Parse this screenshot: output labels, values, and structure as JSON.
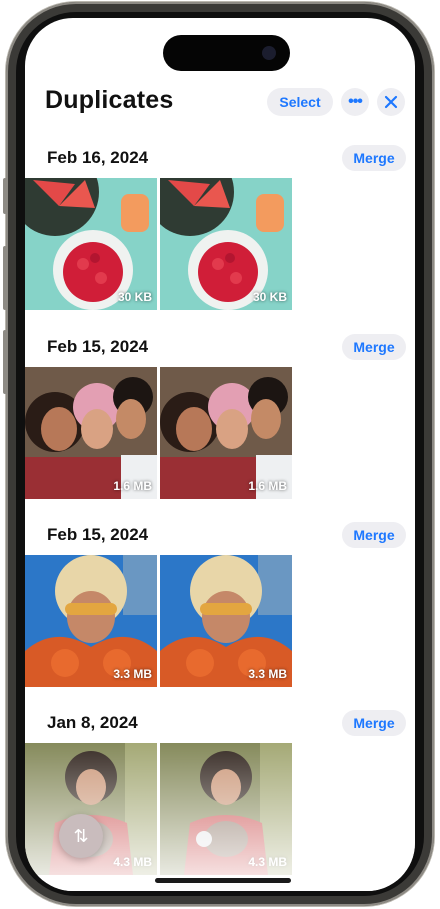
{
  "header": {
    "title": "Duplicates",
    "select_label": "Select",
    "more_label": "•••",
    "close_label": "✕"
  },
  "groups": [
    {
      "date": "Feb 16, 2024",
      "merge_label": "Merge",
      "items": [
        {
          "size": "30 KB"
        },
        {
          "size": "30 KB"
        }
      ]
    },
    {
      "date": "Feb 15, 2024",
      "merge_label": "Merge",
      "items": [
        {
          "size": "1.6 MB"
        },
        {
          "size": "1.6 MB"
        }
      ]
    },
    {
      "date": "Feb 15, 2024",
      "merge_label": "Merge",
      "items": [
        {
          "size": "3.3 MB"
        },
        {
          "size": "3.3 MB"
        }
      ]
    },
    {
      "date": "Jan 8, 2024",
      "merge_label": "Merge",
      "items": [
        {
          "size": "4.3 MB"
        },
        {
          "size": "4.3 MB"
        }
      ]
    }
  ],
  "sort_button": {
    "icon": "sort-arrows-icon",
    "glyph": "⇅"
  },
  "colors": {
    "accent": "#1e78ff",
    "pill_bg": "#eeeef2"
  }
}
